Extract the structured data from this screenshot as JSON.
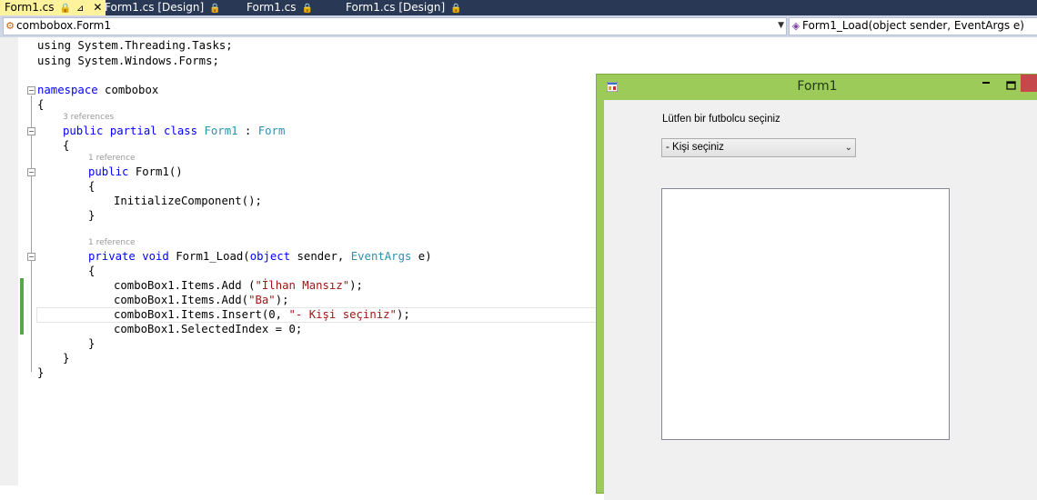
{
  "tabs": [
    {
      "label": "Form1.cs",
      "active": true
    },
    {
      "label": "Form1.cs [Design]"
    },
    {
      "label": "Form1.cs"
    },
    {
      "label": "Form1.cs [Design]"
    }
  ],
  "nav": {
    "class_combo": "combobox.Form1",
    "member_combo": "Form1_Load(object sender, EventArgs e)"
  },
  "code": {
    "using1": "using System.Threading.Tasks;",
    "using2": "using System.Windows.Forms;",
    "ns_kw": "namespace",
    "ns_name": " combobox",
    "brace_open": "{",
    "brace_close": "}",
    "lens_class": "3 references",
    "class_kw": "public partial class ",
    "class_name": "Form1",
    "class_sep": " : ",
    "class_base": "Form",
    "lens_ctor": "1 reference",
    "ctor_kw": "public",
    "ctor_name": " Form1()",
    "init_call": "InitializeComponent();",
    "lens_load": "1 reference",
    "load_kw": "private void",
    "load_name": " Form1_Load(",
    "load_obj": "object",
    "load_sender": " sender, ",
    "load_eventargs": "EventArgs",
    "load_e": " e)",
    "add1_pre": "comboBox1.Items.Add (",
    "add1_str": "\"İlhan Mansız\"",
    "add1_post": ");",
    "add2_pre": "comboBox1.Items.Add(",
    "add2_str": "\"Ba\"",
    "add2_post": ");",
    "insert_pre": "comboBox1.Items.Insert(0, ",
    "insert_str": "\"- Kişi seçiniz\"",
    "insert_post": ");",
    "selected_index": "comboBox1.SelectedIndex = 0;"
  },
  "form": {
    "title": "Form1",
    "label": "Lütfen bir futbolcu seçiniz",
    "combo_value": "- Kişi seçiniz"
  },
  "colors": {
    "keyword": "#0000ff",
    "type": "#2b91af",
    "string": "#a31515",
    "tab_bar": "#293955",
    "active_tab": "#fff29d",
    "form_chrome": "#9ccb5a",
    "close_button": "#c7484c"
  }
}
